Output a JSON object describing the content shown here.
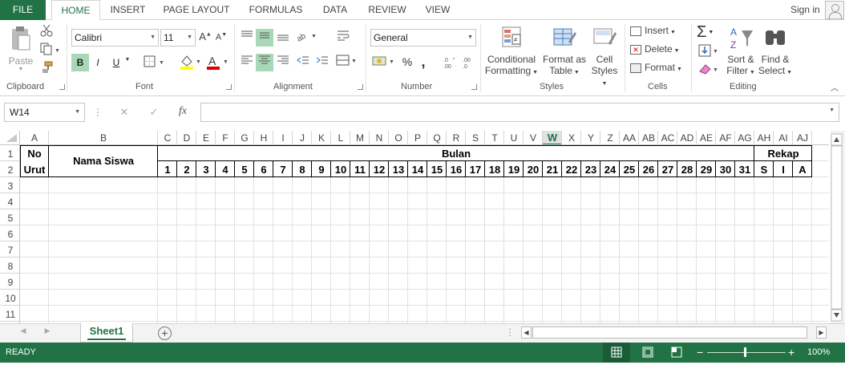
{
  "tabs": {
    "file": "FILE",
    "home": "HOME",
    "insert": "INSERT",
    "page_layout": "PAGE LAYOUT",
    "formulas": "FORMULAS",
    "data": "DATA",
    "review": "REVIEW",
    "view": "VIEW"
  },
  "account": {
    "sign_in": "Sign in"
  },
  "ribbon": {
    "clipboard": {
      "label": "Clipboard",
      "paste": "Paste"
    },
    "font": {
      "label": "Font",
      "name": "Calibri",
      "size": "11",
      "bold": "B",
      "italic": "I",
      "underline": "U"
    },
    "alignment": {
      "label": "Alignment"
    },
    "number": {
      "label": "Number",
      "format": "General",
      "percent": "%",
      "comma": ","
    },
    "styles": {
      "label": "Styles",
      "conditional_1": "Conditional",
      "conditional_2": "Formatting",
      "format_table_1": "Format as",
      "format_table_2": "Table",
      "cell_styles_1": "Cell",
      "cell_styles_2": "Styles"
    },
    "cells": {
      "label": "Cells",
      "insert": "Insert",
      "delete": "Delete",
      "format": "Format"
    },
    "editing": {
      "label": "Editing",
      "sort_1": "Sort &",
      "sort_2": "Filter",
      "find_1": "Find &",
      "find_2": "Select"
    }
  },
  "formula_bar": {
    "name_box": "W14",
    "fx": "fx",
    "cancel": "✕",
    "enter": "✓",
    "formula": ""
  },
  "grid": {
    "columns": [
      "A",
      "B",
      "C",
      "D",
      "E",
      "F",
      "G",
      "H",
      "I",
      "J",
      "K",
      "L",
      "M",
      "N",
      "O",
      "P",
      "Q",
      "R",
      "S",
      "T",
      "U",
      "V",
      "W",
      "X",
      "Y",
      "Z",
      "AA",
      "AB",
      "AC",
      "AD",
      "AE",
      "AF",
      "AG",
      "AH",
      "AI",
      "AJ"
    ],
    "selected_column": "W",
    "rows": [
      "1",
      "2",
      "3",
      "4",
      "5",
      "6",
      "7",
      "8",
      "9",
      "10",
      "11"
    ],
    "no_top": "No",
    "no_bottom": "Urut",
    "nama": "Nama Siswa",
    "bulan": "Bulan",
    "days": [
      "1",
      "2",
      "3",
      "4",
      "5",
      "6",
      "7",
      "8",
      "9",
      "10",
      "11",
      "12",
      "13",
      "14",
      "15",
      "16",
      "17",
      "18",
      "19",
      "20",
      "21",
      "22",
      "23",
      "24",
      "25",
      "26",
      "27",
      "28",
      "29",
      "30",
      "31"
    ],
    "rekap": "Rekap",
    "rekap_items": [
      "S",
      "I",
      "A"
    ]
  },
  "sheets": {
    "active": "Sheet1"
  },
  "status": {
    "ready": "READY",
    "zoom": "100%"
  },
  "colors": {
    "accent": "#217346",
    "grid_line": "#d4d4d4",
    "selected_header": "#217346"
  }
}
